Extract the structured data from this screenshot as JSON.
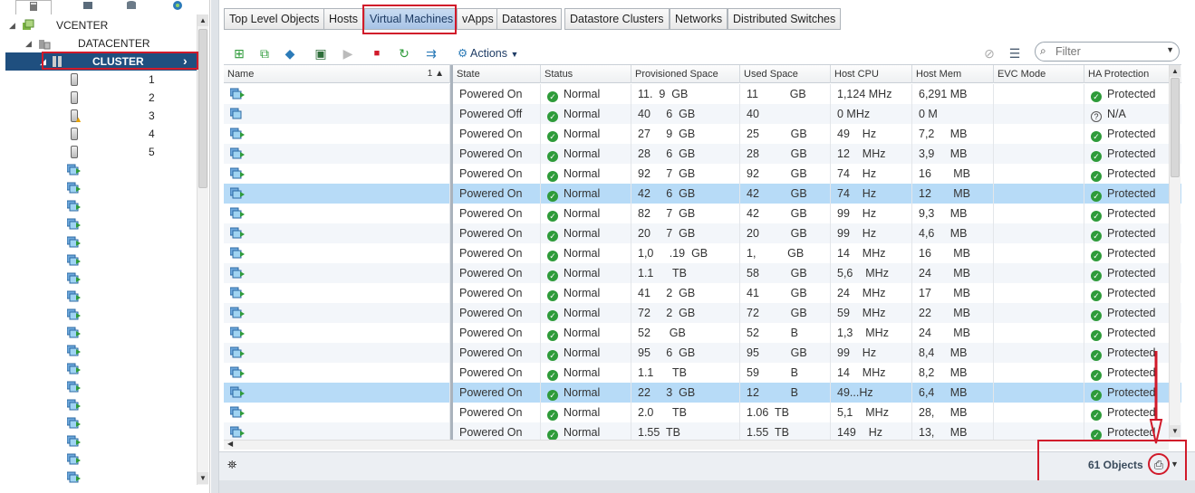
{
  "navigator": {
    "tab_icons": [
      "hosts-clusters-icon",
      "vms-templates-icon",
      "storage-icon",
      "networking-icon"
    ],
    "tree": [
      {
        "label": "VCENTER",
        "icon": "vcenter-icon",
        "indent": 0,
        "expanded": true
      },
      {
        "label": "DATACENTER",
        "icon": "datacenter-icon",
        "indent": 1,
        "expanded": true
      },
      {
        "label": "CLUSTER",
        "icon": "cluster-icon",
        "indent": 2,
        "expanded": true,
        "selected": true
      },
      {
        "label": "1",
        "icon": "host-icon",
        "indent": 3
      },
      {
        "label": "2",
        "icon": "host-icon",
        "indent": 3
      },
      {
        "label": "3",
        "icon": "host-warning-icon",
        "indent": 3
      },
      {
        "label": "4",
        "icon": "host-icon",
        "indent": 3
      },
      {
        "label": "5",
        "icon": "host-icon",
        "indent": 3
      }
    ]
  },
  "tabs": [
    {
      "label": "Top Level Objects",
      "active": false
    },
    {
      "label": "Hosts",
      "active": false
    },
    {
      "label": "Virtual Machines",
      "active": true
    },
    {
      "label": "vApps",
      "active": false
    },
    {
      "label": "Datastores",
      "active": false
    },
    {
      "label": "Datastore Clusters",
      "active": false
    },
    {
      "label": "Networks",
      "active": false
    },
    {
      "label": "Distributed Switches",
      "active": false
    }
  ],
  "toolbar": {
    "icons": [
      "new-vm-icon",
      "clone-vm-icon",
      "deploy-ovf-icon",
      "open-console-icon",
      "power-on-icon",
      "power-off-icon",
      "reset-icon",
      "migrate-icon"
    ],
    "actions_label": "Actions",
    "filter_placeholder": "Filter"
  },
  "grid": {
    "columns": [
      "Name",
      "State",
      "Status",
      "Provisioned Space",
      "Used Space",
      "Host CPU",
      "Host Mem",
      "EVC Mode",
      "HA Protection"
    ],
    "sort_indicator": "1 ▲",
    "rows": [
      {
        "state": "Powered On",
        "status": "Normal",
        "prov": "11.  9  GB",
        "used": "11          GB",
        "cpu": "1,124 MHz",
        "mem": "6,291 MB",
        "ha": "Protected",
        "selected": false
      },
      {
        "state": "Powered Off",
        "status": "Normal",
        "prov": "40     6  GB",
        "used": "40",
        "cpu": "0 MHz",
        "mem": "0 M",
        "ha": "N/A",
        "selected": false
      },
      {
        "state": "Powered On",
        "status": "Normal",
        "prov": "27     9  GB",
        "used": "25          GB",
        "cpu": "49    Hz",
        "mem": "7,2     MB",
        "ha": "Protected",
        "selected": false
      },
      {
        "state": "Powered On",
        "status": "Normal",
        "prov": "28     6  GB",
        "used": "28          GB",
        "cpu": "12    MHz",
        "mem": "3,9     MB",
        "ha": "Protected",
        "selected": false
      },
      {
        "state": "Powered On",
        "status": "Normal",
        "prov": "92     7  GB",
        "used": "92          GB",
        "cpu": "74    Hz",
        "mem": "16       MB",
        "ha": "Protected",
        "selected": false
      },
      {
        "state": "Powered On",
        "status": "Normal",
        "prov": "42     6  GB",
        "used": "42          GB",
        "cpu": "74    Hz",
        "mem": "12       MB",
        "ha": "Protected",
        "selected": true
      },
      {
        "state": "Powered On",
        "status": "Normal",
        "prov": "82     7  GB",
        "used": "42          GB",
        "cpu": "99    Hz",
        "mem": "9,3     MB",
        "ha": "Protected",
        "selected": false
      },
      {
        "state": "Powered On",
        "status": "Normal",
        "prov": "20     7  GB",
        "used": "20          GB",
        "cpu": "99    Hz",
        "mem": "4,6     MB",
        "ha": "Protected",
        "selected": false
      },
      {
        "state": "Powered On",
        "status": "Normal",
        "prov": "1,0     .19  GB",
        "used": "1,          GB",
        "cpu": "14    MHz",
        "mem": "16       MB",
        "ha": "Protected",
        "selected": false
      },
      {
        "state": "Powered On",
        "status": "Normal",
        "prov": "1.1      TB",
        "used": "58          GB",
        "cpu": "5,6    MHz",
        "mem": "24       MB",
        "ha": "Protected",
        "selected": false
      },
      {
        "state": "Powered On",
        "status": "Normal",
        "prov": "41     2  GB",
        "used": "41          GB",
        "cpu": "24    MHz",
        "mem": "17       MB",
        "ha": "Protected",
        "selected": false
      },
      {
        "state": "Powered On",
        "status": "Normal",
        "prov": "72     2  GB",
        "used": "72          GB",
        "cpu": "59    MHz",
        "mem": "22       MB",
        "ha": "Protected",
        "selected": false
      },
      {
        "state": "Powered On",
        "status": "Normal",
        "prov": "52      GB",
        "used": "52          B",
        "cpu": "1,3    MHz",
        "mem": "24       MB",
        "ha": "Protected",
        "selected": false
      },
      {
        "state": "Powered On",
        "status": "Normal",
        "prov": "95     6  GB",
        "used": "95          GB",
        "cpu": "99    Hz",
        "mem": "8,4     MB",
        "ha": "Protected",
        "selected": false
      },
      {
        "state": "Powered On",
        "status": "Normal",
        "prov": "1.1      TB",
        "used": "59          B",
        "cpu": "14    MHz",
        "mem": "8,2     MB",
        "ha": "Protected",
        "selected": false
      },
      {
        "state": "Powered On",
        "status": "Normal",
        "prov": "22     3  GB",
        "used": "12          B",
        "cpu": "49...Hz",
        "mem": "6,4     MB",
        "ha": "Protected",
        "selected": true
      },
      {
        "state": "Powered On",
        "status": "Normal",
        "prov": "2.0      TB",
        "used": "1.06  TB",
        "cpu": "5,1    MHz",
        "mem": "28,     MB",
        "ha": "Protected",
        "selected": false
      },
      {
        "state": "Powered On",
        "status": "Normal",
        "prov": "1.55  TB",
        "used": "1.55  TB",
        "cpu": "149    Hz",
        "mem": "13,     MB",
        "ha": "Protected",
        "selected": false
      }
    ]
  },
  "status": {
    "objects_count": "61 Objects"
  },
  "colors": {
    "selection_nav": "#1f4f7f",
    "selection_grid": "#b7dbf7",
    "status_ok": "#2e9b3a",
    "highlight": "#d11a2a"
  }
}
